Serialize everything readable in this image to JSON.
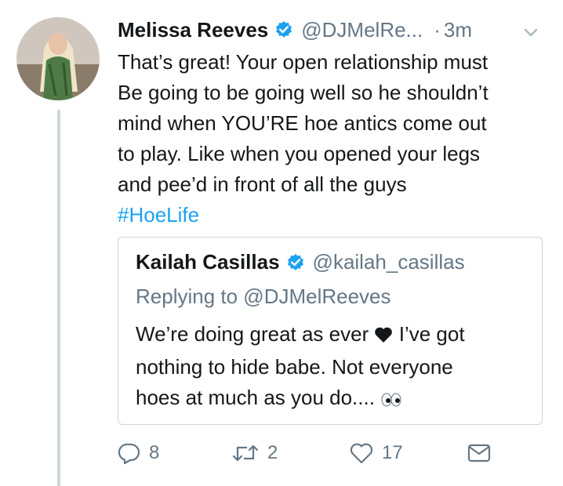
{
  "tweet": {
    "author_name": "Melissa Reeves",
    "author_handle": "@DJMelRe...",
    "separator": "·",
    "time": "3m",
    "text_lines": [
      "That’s great! Your open relationship must",
      "Be going to be going well so he shouldn’t",
      "mind when YOU’RE hoe antics come out",
      "to play. Like when you opened your legs",
      "and pee’d in front of all the guys"
    ],
    "hashtag": "#HoeLife"
  },
  "quote": {
    "author_name": "Kailah Casillas",
    "author_handle": "@kailah_casillas",
    "replying_to": "Replying to @DJMelReeves",
    "line1_before_heart": "We’re doing great as ever",
    "line1_after_heart": "I’ve got",
    "line2": "nothing to hide babe. Not everyone",
    "line3": "hoes at much as you do...."
  },
  "actions": {
    "reply_count": "8",
    "retweet_count": "2",
    "like_count": "17"
  },
  "colors": {
    "link": "#1da1f2",
    "muted": "#657786",
    "border": "#ccd6dd",
    "text": "#14171a"
  },
  "icons": [
    "verified-badge-icon",
    "chevron-down-icon",
    "heart-emoji-icon",
    "eyes-emoji-icon",
    "reply-icon",
    "retweet-icon",
    "like-icon",
    "direct-message-icon"
  ]
}
